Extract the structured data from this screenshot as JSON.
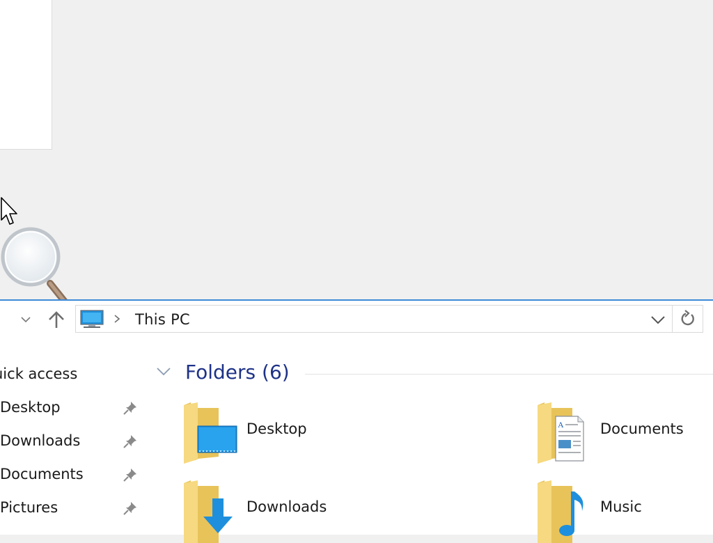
{
  "window": {
    "accent_color": "#3c8ad8"
  },
  "address_bar": {
    "location_icon": "this-pc-icon",
    "breadcrumb": "This PC"
  },
  "nav_pane": {
    "quick_access_label": "uick access",
    "items": [
      {
        "label": "Desktop",
        "pinned": true
      },
      {
        "label": "Downloads",
        "pinned": true
      },
      {
        "label": "Documents",
        "pinned": true
      },
      {
        "label": "Pictures",
        "pinned": true
      }
    ]
  },
  "content": {
    "group_title": "Folders (6)",
    "group_title_color": "#1e3287",
    "folders": [
      {
        "label": "Desktop",
        "icon": "desktop-folder-icon"
      },
      {
        "label": "Documents",
        "icon": "documents-folder-icon"
      },
      {
        "label": "Downloads",
        "icon": "downloads-folder-icon"
      },
      {
        "label": "Music",
        "icon": "music-folder-icon"
      }
    ]
  }
}
